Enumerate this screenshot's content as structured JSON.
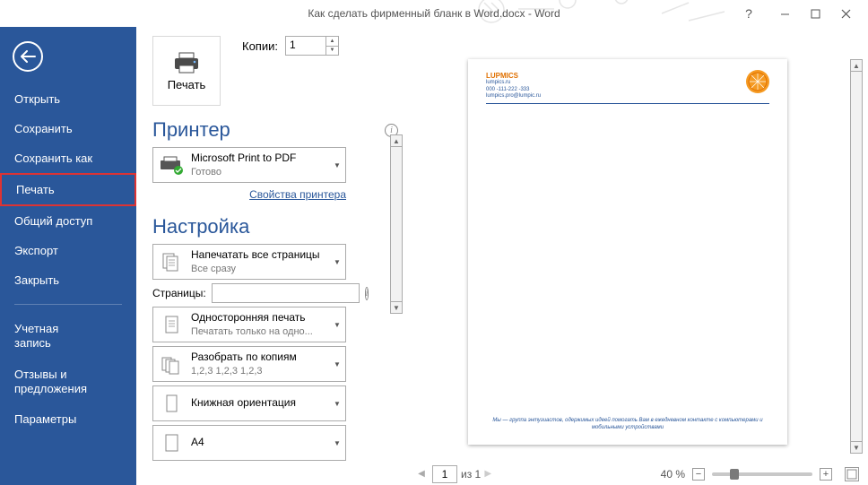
{
  "window": {
    "title": "Как сделать фирменный бланк в Word.docx  -  Word"
  },
  "sidebar": {
    "items": [
      {
        "label": "Открыть"
      },
      {
        "label": "Сохранить"
      },
      {
        "label": "Сохранить как"
      },
      {
        "label": "Печать"
      },
      {
        "label": "Общий доступ"
      },
      {
        "label": "Экспорт"
      },
      {
        "label": "Закрыть"
      },
      {
        "label": "Учетная\nзапись"
      },
      {
        "label": "Отзывы и\nпредложения"
      },
      {
        "label": "Параметры"
      }
    ],
    "active_index": 3
  },
  "print": {
    "copies_label": "Копии:",
    "copies_value": "1",
    "print_button": "Печать",
    "printer_header": "Принтер",
    "printer": {
      "name": "Microsoft Print to PDF",
      "status": "Готово"
    },
    "printer_properties_link": "Свойства принтера",
    "settings_header": "Настройка",
    "print_scope": {
      "title": "Напечатать все страницы",
      "sub": "Все сразу"
    },
    "pages_label": "Страницы:",
    "pages_value": "",
    "sides": {
      "title": "Односторонняя печать",
      "sub": "Печатать только на одно..."
    },
    "collate": {
      "title": "Разобрать по копиям",
      "sub": "1,2,3    1,2,3    1,2,3"
    },
    "orientation": {
      "title": "Книжная ориентация"
    },
    "paper": {
      "title": "A4"
    }
  },
  "preview": {
    "company": "LUPMICS",
    "company_site": "lumpics.ru",
    "phone": "000 -111-222 -333",
    "email": "lumpics.pro@lumpic.ru",
    "footer": "Мы — группа энтузиастов, одержимых идеей помогать Вам в ежедневном контакте с компьютерами и мобильными устройствами"
  },
  "footer": {
    "page_current": "1",
    "page_of": "из 1",
    "zoom": "40 %"
  }
}
